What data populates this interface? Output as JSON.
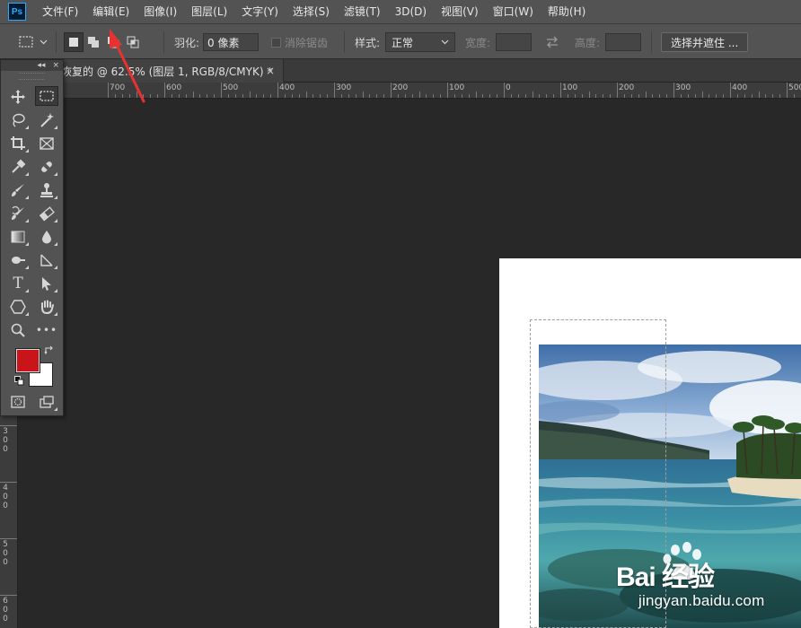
{
  "app": {
    "logo": "Ps"
  },
  "menu": [
    {
      "label": "文件(F)"
    },
    {
      "label": "编辑(E)"
    },
    {
      "label": "图像(I)"
    },
    {
      "label": "图层(L)"
    },
    {
      "label": "文字(Y)"
    },
    {
      "label": "选择(S)"
    },
    {
      "label": "滤镜(T)"
    },
    {
      "label": "3D(D)"
    },
    {
      "label": "视图(V)"
    },
    {
      "label": "窗口(W)"
    },
    {
      "label": "帮助(H)"
    }
  ],
  "options": {
    "feather_label": "羽化:",
    "feather_value": "0 像素",
    "antialias_label": "消除锯齿",
    "style_label": "样式:",
    "style_value": "正常",
    "width_label": "宽度:",
    "width_value": "",
    "height_label": "高度:",
    "height_value": "",
    "select_mask_button": "选择并遮住 ..."
  },
  "document": {
    "tab_title": "恢复的 @ 62.5% (图层 1, RGB/8/CMYK) *",
    "close_glyph": "×"
  },
  "ruler_top_labels": [
    "700",
    "600",
    "500",
    "400",
    "300",
    "200",
    "100",
    "0",
    "100",
    "200",
    "300",
    "400",
    "500"
  ],
  "ruler_left_labels": [
    "300",
    "400",
    "500",
    "600"
  ],
  "tools": [
    {
      "name": "move-tool-icon"
    },
    {
      "name": "rectangular-marquee-tool-icon"
    },
    {
      "name": "lasso-tool-icon"
    },
    {
      "name": "magic-wand-tool-icon"
    },
    {
      "name": "crop-tool-icon"
    },
    {
      "name": "frame-tool-icon"
    },
    {
      "name": "eyedropper-tool-icon"
    },
    {
      "name": "healing-brush-tool-icon"
    },
    {
      "name": "brush-tool-icon"
    },
    {
      "name": "clone-stamp-tool-icon"
    },
    {
      "name": "history-brush-tool-icon"
    },
    {
      "name": "eraser-tool-icon"
    },
    {
      "name": "gradient-tool-icon"
    },
    {
      "name": "blur-tool-icon"
    },
    {
      "name": "dodge-tool-icon"
    },
    {
      "name": "pen-tool-icon"
    },
    {
      "name": "type-tool-icon"
    },
    {
      "name": "path-selection-tool-icon"
    },
    {
      "name": "shape-tool-icon"
    },
    {
      "name": "hand-tool-icon"
    },
    {
      "name": "zoom-tool-icon"
    },
    {
      "name": "more-tools-icon"
    }
  ],
  "panel_head_glyphs": {
    "collapse": "◂◂",
    "close": "×"
  },
  "type_tool_glyph": "T",
  "more_tools_glyph": "•••",
  "colors": {
    "foreground": "#c91419",
    "background": "#ffffff",
    "annotation_arrow": "#e8322f"
  },
  "watermark": {
    "brand": "Bai 经验",
    "url": "jingyan.baidu.com"
  }
}
